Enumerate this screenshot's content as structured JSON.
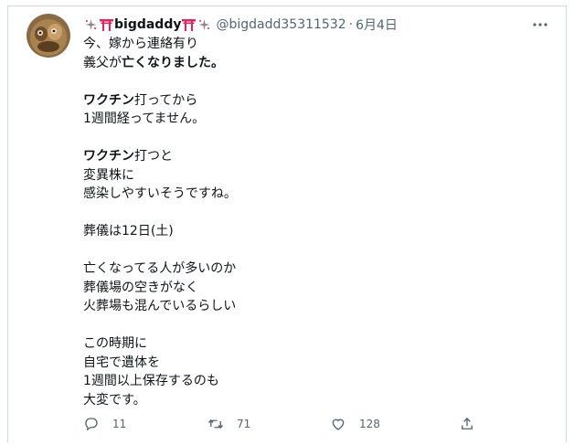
{
  "tweet": {
    "display_name": "bigdaddy",
    "handle": "@bigdadd35311532",
    "separator": "·",
    "date": "6月4日",
    "lines": [
      {
        "pre": "今、嫁から連絡有り",
        "bold": "",
        "post": ""
      },
      {
        "pre": "義父が",
        "bold": "亡くなりました。",
        "post": ""
      },
      {
        "pre": "",
        "bold": "",
        "post": ""
      },
      {
        "pre": "",
        "bold": "ワクチン",
        "post": "打ってから"
      },
      {
        "pre": "1週間経ってません。",
        "bold": "",
        "post": ""
      },
      {
        "pre": "",
        "bold": "",
        "post": ""
      },
      {
        "pre": "",
        "bold": "ワクチン",
        "post": "打つと"
      },
      {
        "pre": "変異株に",
        "bold": "",
        "post": ""
      },
      {
        "pre": "感染しやすいそうですね。",
        "bold": "",
        "post": ""
      },
      {
        "pre": "",
        "bold": "",
        "post": ""
      },
      {
        "pre": "葬儀は12日(土)",
        "bold": "",
        "post": ""
      },
      {
        "pre": "",
        "bold": "",
        "post": ""
      },
      {
        "pre": "亡くなってる人が多いのか",
        "bold": "",
        "post": ""
      },
      {
        "pre": "葬儀場の空きがなく",
        "bold": "",
        "post": ""
      },
      {
        "pre": "火葬場も混んでいるらしい",
        "bold": "",
        "post": ""
      },
      {
        "pre": "",
        "bold": "",
        "post": ""
      },
      {
        "pre": "この時期に",
        "bold": "",
        "post": ""
      },
      {
        "pre": "自宅で遺体を",
        "bold": "",
        "post": ""
      },
      {
        "pre": "1週間以上保存するのも",
        "bold": "",
        "post": ""
      },
      {
        "pre": "大変です。",
        "bold": "",
        "post": ""
      }
    ]
  },
  "actions": {
    "reply_count": "11",
    "retweet_count": "71",
    "like_count": "128"
  },
  "icons": {
    "reply": "reply-icon",
    "retweet": "retweet-icon",
    "like": "heart-icon",
    "share": "share-icon",
    "more": "more-icon"
  },
  "colors": {
    "text": "#0f1419",
    "secondary": "#536471",
    "border": "#cfd9de",
    "torii": "#e0245e"
  }
}
